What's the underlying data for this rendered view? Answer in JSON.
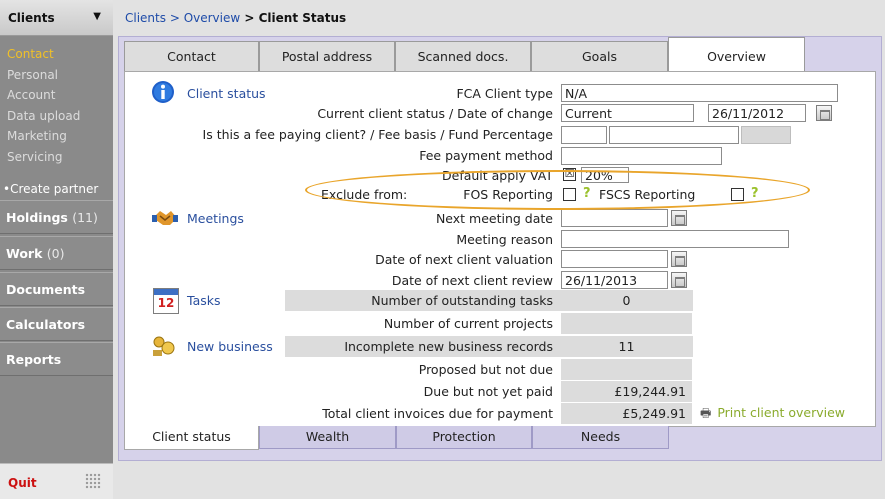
{
  "sidebar": {
    "title": "Clients",
    "caret_icon": "caret-down-icon",
    "sub_items": [
      {
        "label": "Contact",
        "active": true
      },
      {
        "label": "Personal"
      },
      {
        "label": "Account"
      },
      {
        "label": "Data upload"
      },
      {
        "label": "Marketing"
      },
      {
        "label": "Servicing"
      }
    ],
    "create_partner": "Create partner",
    "sections": [
      {
        "label": "Holdings",
        "count": "(11)"
      },
      {
        "label": "Work",
        "count": "(0)"
      },
      {
        "label": "Documents",
        "count": ""
      },
      {
        "label": "Calculators",
        "count": ""
      },
      {
        "label": "Reports",
        "count": ""
      }
    ],
    "quit": "Quit"
  },
  "breadcrumb": {
    "part1": "Clients",
    "sep1": " > ",
    "part2": "Overview",
    "sep2": " > ",
    "current": "Client Status"
  },
  "top_tabs": [
    {
      "label": "Contact"
    },
    {
      "label": "Postal address"
    },
    {
      "label": "Scanned docs."
    },
    {
      "label": "Goals"
    },
    {
      "label": "Overview",
      "active": true
    }
  ],
  "client_status": {
    "section_label": "Client status",
    "fca_label": "FCA Client type",
    "fca_value": "N/A",
    "status_label": "Current client status / Date of change",
    "status_value": "Current",
    "status_date": "26/11/2012",
    "fee_label": "Is this a fee paying client? / Fee basis / Fund Percentage",
    "fee_method_label": "Fee payment method",
    "vat_label": "Default apply VAT",
    "vat_checked": "☒",
    "vat_value": "20%",
    "exclude_label": "Exclude from:",
    "fos_label": "FOS Reporting",
    "fscs_label": "FSCS Reporting",
    "help": "?"
  },
  "meetings": {
    "section_label": "Meetings",
    "next_meeting_label": "Next meeting date",
    "reason_label": "Meeting reason",
    "valuation_label": "Date of next client valuation",
    "review_label": "Date of next client review",
    "review_value": "26/11/2013"
  },
  "tasks": {
    "section_label": "Tasks",
    "calendar_number": "12",
    "outstanding_label": "Number of outstanding tasks",
    "outstanding_value": "0",
    "projects_label": "Number of current projects",
    "projects_value": ""
  },
  "new_business": {
    "section_label": "New business",
    "incomplete_label": "Incomplete new business records",
    "incomplete_value": "11",
    "proposed_label": "Proposed but not due",
    "proposed_value": "",
    "due_label": "Due but not yet paid",
    "due_value": "£19,244.91",
    "total_label": "Total client invoices due for payment",
    "total_value": "£5,249.91"
  },
  "print_link": "Print client overview",
  "bottom_tabs": [
    {
      "label": "Client status",
      "active": true
    },
    {
      "label": "Wealth"
    },
    {
      "label": "Protection"
    },
    {
      "label": "Needs"
    }
  ],
  "colors": {
    "link_blue": "#2a4f9e",
    "accent_yellow": "#f0c028",
    "quit_red": "#cc1111",
    "help_green": "#9bc12c",
    "highlight_orange": "#e9a52b",
    "panel_lilac": "#d6d2ea"
  }
}
